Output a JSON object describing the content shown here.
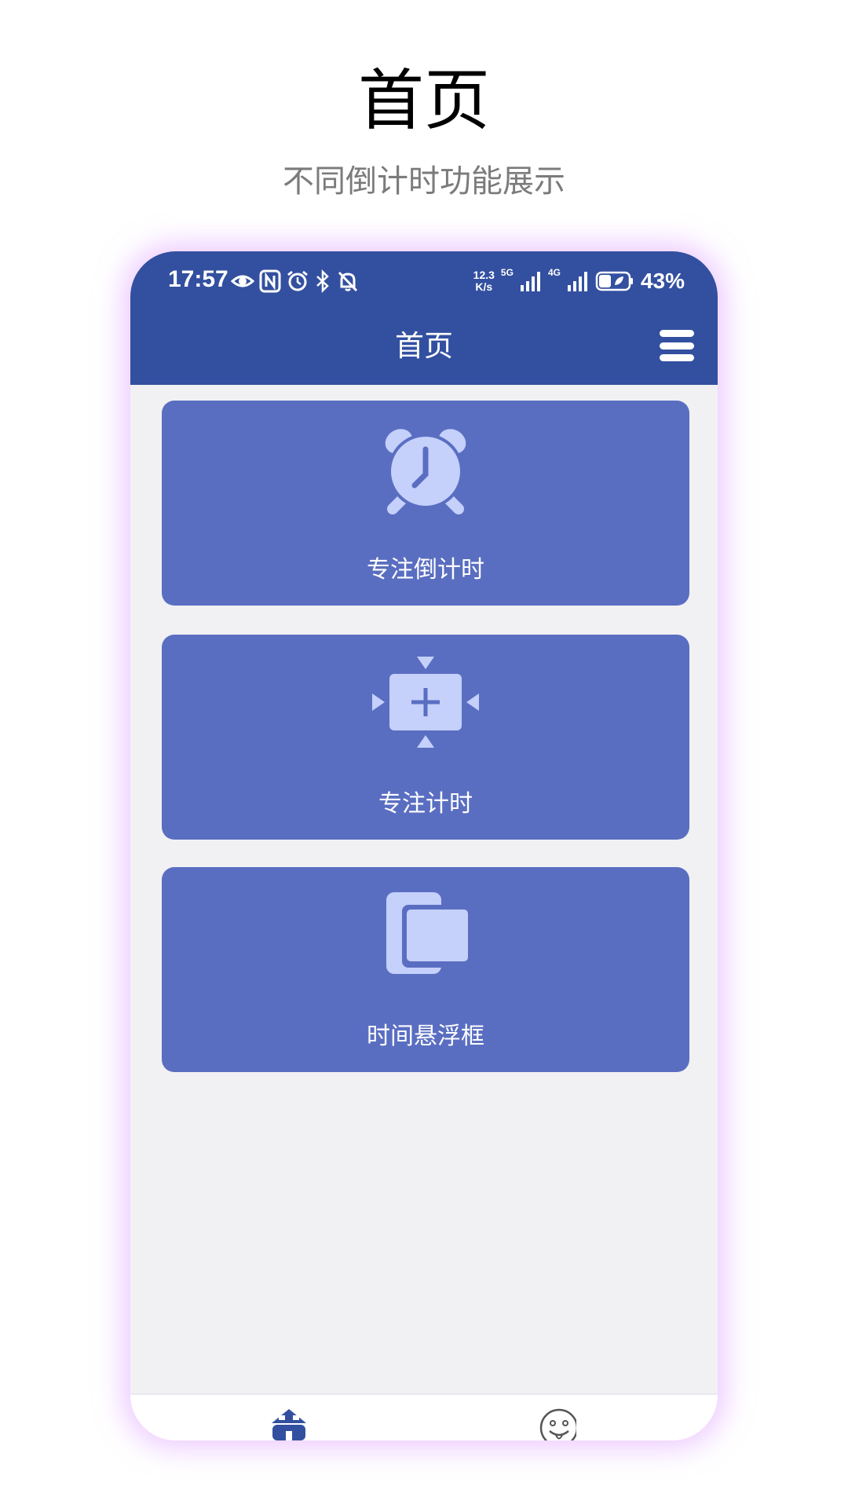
{
  "promo": {
    "title": "首页",
    "subtitle": "不同倒计时功能展示"
  },
  "status_bar": {
    "time": "17:57",
    "net_speed_value": "12.3",
    "net_speed_unit": "K/s",
    "sim1_tag": "5G",
    "sim2_tag": "4G",
    "battery": "43%",
    "battery_level": 0.43
  },
  "app_bar": {
    "title": "首页",
    "menu_icon": "hamburger-menu-icon"
  },
  "cards": [
    {
      "label": "专注倒计时",
      "icon": "alarm-clock-icon"
    },
    {
      "label": "专注计时",
      "icon": "timer-plus-icon"
    },
    {
      "label": "时间悬浮框",
      "icon": "floating-window-icon"
    }
  ],
  "bottom_nav": {
    "items": [
      {
        "icon": "home-icon",
        "active": true
      },
      {
        "icon": "smiley-icon",
        "active": false
      }
    ]
  },
  "colors": {
    "primary": "#3350a0",
    "card": "#5a6ec1",
    "icon_fill": "#c5d0fb",
    "background": "#f1f1f4",
    "subtitle": "#7b7b7b"
  }
}
